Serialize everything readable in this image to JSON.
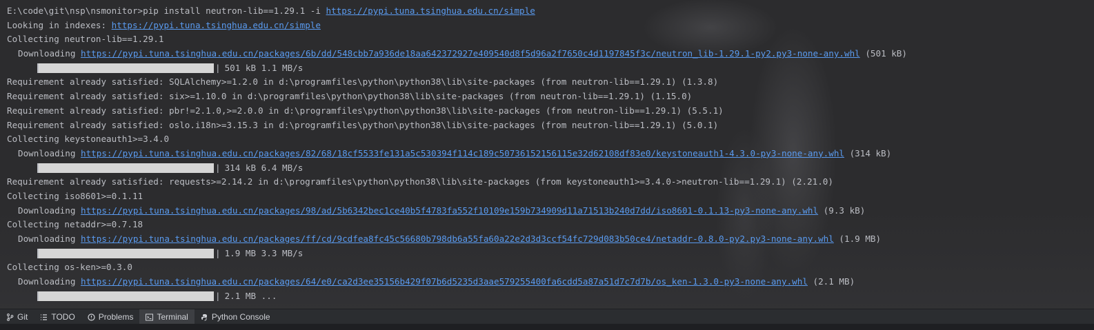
{
  "terminal": {
    "lines": [
      {
        "pre": "E:\\code\\git\\nsp\\nsmonitor>pip install neutron-lib==1.29.1 -i ",
        "link": "https://pypi.tuna.tsinghua.edu.cn/simple",
        "post": ""
      },
      {
        "pre": "Looking in indexes: ",
        "link": "https://pypi.tuna.tsinghua.edu.cn/simple",
        "post": ""
      },
      {
        "pre": "Collecting neutron-lib==1.29.1"
      },
      {
        "pre": "Downloading ",
        "link": "https://pypi.tuna.tsinghua.edu.cn/packages/6b/dd/548cbb7a936de18aa642372927e409540d8f5d96a2f7650c4d1197845f3c/neutron_lib-1.29.1-py2.py3-none-any.whl",
        "post": " (501 kB)"
      },
      {
        "progress": "501 kB 1.1 MB/s"
      },
      {
        "pre": "Requirement already satisfied: SQLAlchemy>=1.2.0 in d:\\programfiles\\python\\python38\\lib\\site-packages (from neutron-lib==1.29.1) (1.3.8)"
      },
      {
        "pre": "Requirement already satisfied: six>=1.10.0 in d:\\programfiles\\python\\python38\\lib\\site-packages (from neutron-lib==1.29.1) (1.15.0)"
      },
      {
        "pre": "Requirement already satisfied: pbr!=2.1.0,>=2.0.0 in d:\\programfiles\\python\\python38\\lib\\site-packages (from neutron-lib==1.29.1) (5.5.1)"
      },
      {
        "pre": "Requirement already satisfied: oslo.i18n>=3.15.3 in d:\\programfiles\\python\\python38\\lib\\site-packages (from neutron-lib==1.29.1) (5.0.1)"
      },
      {
        "pre": "Collecting keystoneauth1>=3.4.0"
      },
      {
        "pre": "Downloading ",
        "link": "https://pypi.tuna.tsinghua.edu.cn/packages/82/68/18cf5533fe131a5c530394f114c189c50736152156115e32d62108df83e0/keystoneauth1-4.3.0-py3-none-any.whl",
        "post": " (314 kB)"
      },
      {
        "progress": "314 kB 6.4 MB/s"
      },
      {
        "pre": "Requirement already satisfied: requests>=2.14.2 in d:\\programfiles\\python\\python38\\lib\\site-packages (from keystoneauth1>=3.4.0->neutron-lib==1.29.1) (2.21.0)"
      },
      {
        "pre": "Collecting iso8601>=0.1.11"
      },
      {
        "pre": "Downloading ",
        "link": "https://pypi.tuna.tsinghua.edu.cn/packages/98/ad/5b6342bec1ce40b5f4783fa552f10109e159b734909d11a71513b240d7dd/iso8601-0.1.13-py3-none-any.whl",
        "post": " (9.3 kB)"
      },
      {
        "pre": "Collecting netaddr>=0.7.18"
      },
      {
        "pre": "Downloading ",
        "link": "https://pypi.tuna.tsinghua.edu.cn/packages/ff/cd/9cdfea8fc45c56680b798db6a55fa60a22e2d3d3ccf54fc729d083b50ce4/netaddr-0.8.0-py2.py3-none-any.whl",
        "post": " (1.9 MB)"
      },
      {
        "progress": "1.9 MB 3.3 MB/s"
      },
      {
        "pre": "Collecting os-ken>=0.3.0"
      },
      {
        "pre": "Downloading ",
        "link": "https://pypi.tuna.tsinghua.edu.cn/packages/64/e0/ca2d3ee35156b429f07b6d5235d3aae579255400fa6cdd5a87a51d7c7d7b/os_ken-1.3.0-py3-none-any.whl",
        "post": " (2.1 MB)"
      },
      {
        "progress": "2.1 MB ..."
      }
    ]
  },
  "toolwindow_tabs": [
    {
      "label": "Git",
      "icon": "git-branch-icon"
    },
    {
      "label": "TODO",
      "icon": "list-icon"
    },
    {
      "label": "Problems",
      "icon": "problems-icon"
    },
    {
      "label": "Terminal",
      "icon": "terminal-icon",
      "active": true
    },
    {
      "label": "Python Console",
      "icon": "python-icon"
    }
  ],
  "colors": {
    "background": "#2c2c2e",
    "text": "#bcbec4",
    "link": "#5a9bf0",
    "progress_fill": "#d6d6d6"
  }
}
